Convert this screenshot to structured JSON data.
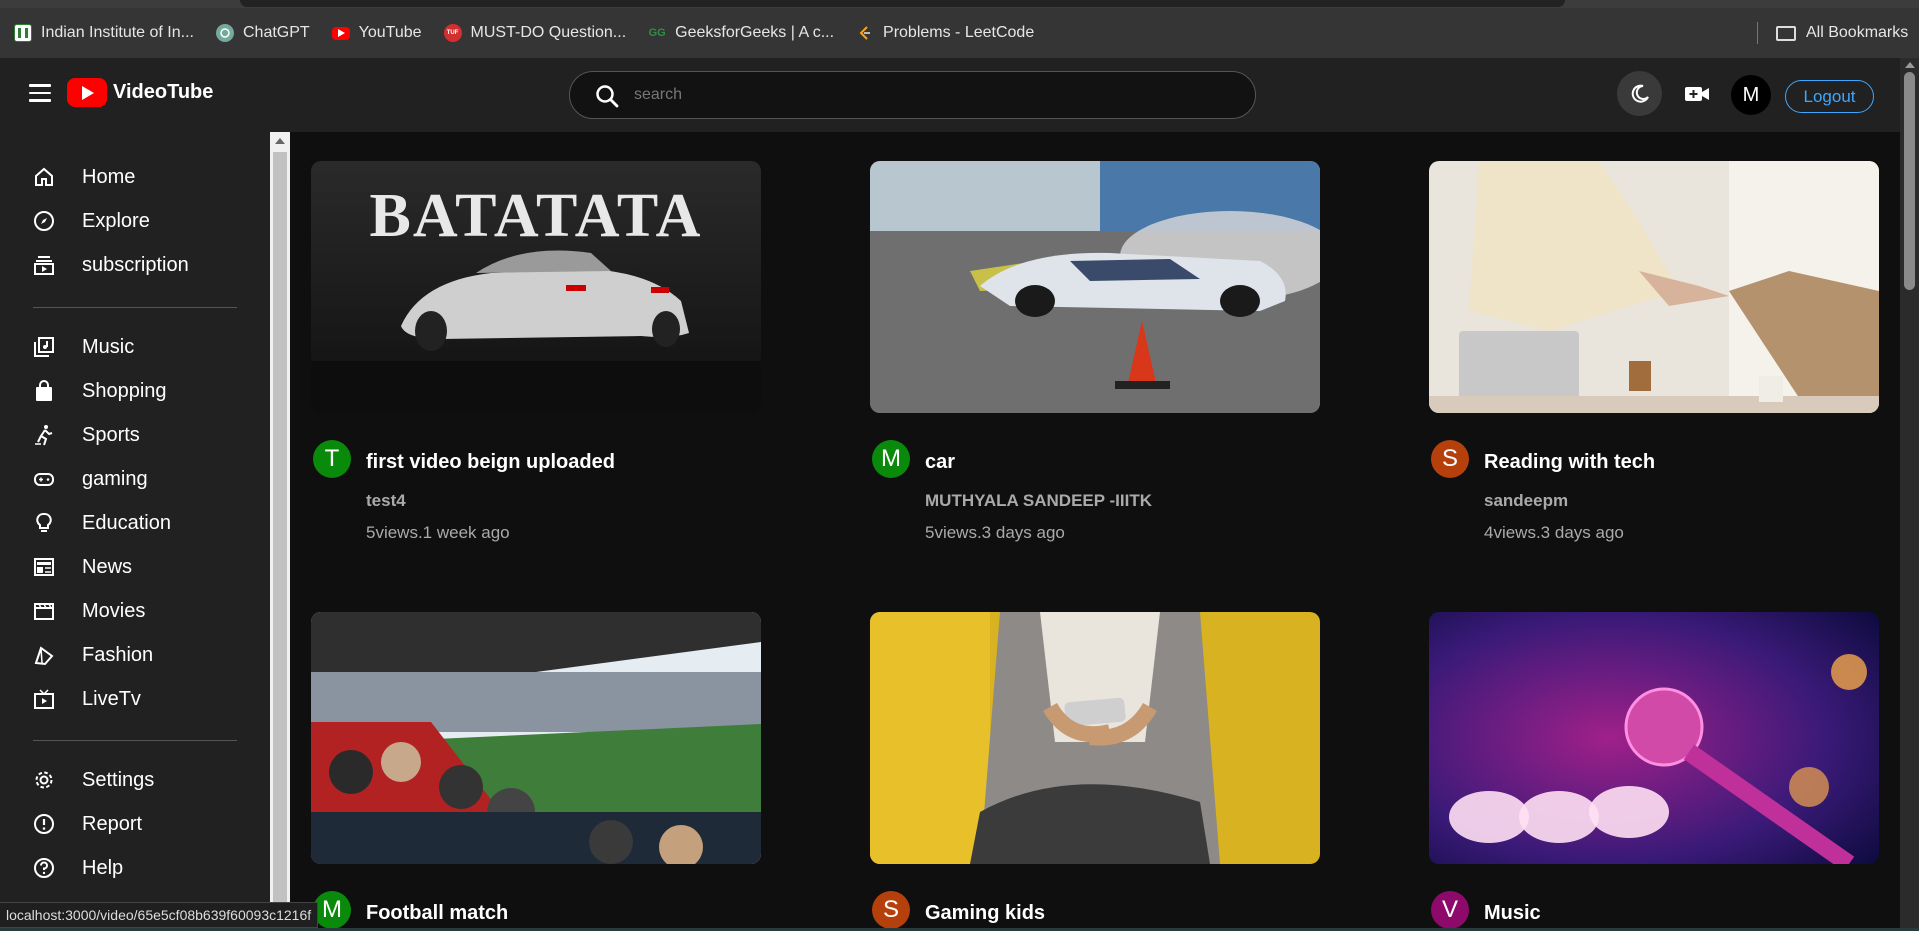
{
  "bookmarks": [
    {
      "label": "Indian Institute of In...",
      "icon": "iiit-icon",
      "color": "#2e7d32"
    },
    {
      "label": "ChatGPT",
      "icon": "chatgpt-icon",
      "color": "#74aa9c"
    },
    {
      "label": "YouTube",
      "icon": "youtube-icon",
      "color": "#ff0000"
    },
    {
      "label": "MUST-DO Question...",
      "icon": "tuf-icon",
      "color": "#d32f2f"
    },
    {
      "label": "GeeksforGeeks | A c...",
      "icon": "gfg-icon",
      "color": "#2f8d46"
    },
    {
      "label": "Problems - LeetCode",
      "icon": "leetcode-icon",
      "color": "#ffa116"
    }
  ],
  "all_bookmarks_label": "All Bookmarks",
  "header": {
    "app_name": "VideoTube",
    "search_placeholder": "search",
    "avatar_initial": "M",
    "logout_label": "Logout"
  },
  "sidebar": {
    "group1": [
      {
        "label": "Home",
        "icon": "home-icon"
      },
      {
        "label": "Explore",
        "icon": "compass-icon"
      },
      {
        "label": "subscription",
        "icon": "subscriptions-icon"
      }
    ],
    "group2": [
      {
        "label": "Music",
        "icon": "music-library-icon"
      },
      {
        "label": "Shopping",
        "icon": "shopping-bag-icon"
      },
      {
        "label": "Sports",
        "icon": "sports-icon"
      },
      {
        "label": "gaming",
        "icon": "gamepad-icon"
      },
      {
        "label": "Education",
        "icon": "lightbulb-icon"
      },
      {
        "label": "News",
        "icon": "newspaper-icon"
      },
      {
        "label": "Movies",
        "icon": "clapperboard-icon"
      },
      {
        "label": "Fashion",
        "icon": "hanger-icon"
      },
      {
        "label": "LiveTv",
        "icon": "live-tv-icon"
      }
    ],
    "group3": [
      {
        "label": "Settings",
        "icon": "gear-icon"
      },
      {
        "label": "Report",
        "icon": "report-icon"
      },
      {
        "label": "Help",
        "icon": "help-icon"
      }
    ]
  },
  "videos": [
    {
      "title": "first video beign uploaded",
      "channel": "test4",
      "meta": "5views.1 week ago",
      "avatar": "T",
      "avatar_color": "#0a8a0a",
      "thumb": "batatata-car"
    },
    {
      "title": "car",
      "channel": "MUTHYALA SANDEEP -IIITK",
      "meta": "5views.3 days ago",
      "avatar": "M",
      "avatar_color": "#0a8a0a",
      "thumb": "drift-car"
    },
    {
      "title": "Reading with tech",
      "channel": "sandeepm",
      "meta": "4views.3 days ago",
      "avatar": "S",
      "avatar_color": "#b5400c",
      "thumb": "handshake"
    },
    {
      "title": "Football match",
      "channel": "",
      "meta": "",
      "avatar": "M",
      "avatar_color": "#0a8a0a",
      "thumb": "stadium"
    },
    {
      "title": "Gaming kids",
      "channel": "",
      "meta": "",
      "avatar": "S",
      "avatar_color": "#b5400c",
      "thumb": "phone-gaming"
    },
    {
      "title": "Music",
      "channel": "",
      "meta": "",
      "avatar": "V",
      "avatar_color": "#8e0a6a",
      "thumb": "microphone"
    }
  ],
  "status_url": "localhost:3000/video/65e5cf08b639f60093c1216f"
}
